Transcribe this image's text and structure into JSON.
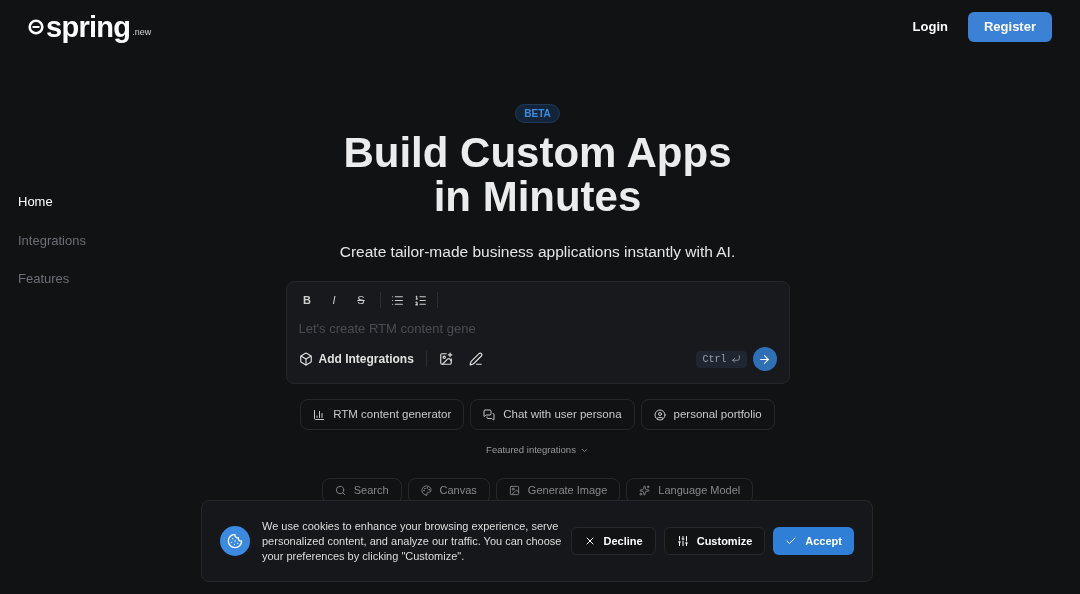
{
  "header": {
    "logo": {
      "name": "spring",
      "suffix": ".new"
    },
    "login": "Login",
    "register": "Register"
  },
  "sidebar": {
    "items": [
      {
        "label": "Home",
        "selected": true
      },
      {
        "label": "Integrations",
        "selected": false
      },
      {
        "label": "Features",
        "selected": false
      }
    ]
  },
  "hero": {
    "badge": "BETA",
    "title_lines": [
      "Build Custom Apps",
      "in Minutes"
    ],
    "subtitle": "Create tailor-made business applications instantly with AI."
  },
  "editor": {
    "toolbar": [
      "B",
      "I",
      "S"
    ],
    "placeholder": "Let's create RTM content gene",
    "add_integrations": "Add Integrations",
    "shortcut": "Ctrl"
  },
  "suggestions": [
    {
      "kind": "chart",
      "label": "RTM content generator"
    },
    {
      "kind": "chat",
      "label": "Chat with user persona"
    },
    {
      "kind": "user",
      "label": "personal portfolio"
    }
  ],
  "featured": {
    "label": "Featured integrations",
    "chips": [
      "Search",
      "Canvas",
      "Generate Image",
      "Language Model"
    ]
  },
  "cookie_banner": {
    "text": "We use cookies to enhance your browsing experience, serve personalized content, and analyze our traffic. You can choose your preferences by clicking \"Customize\".",
    "decline": "Decline",
    "customize": "Customize",
    "accept": "Accept"
  }
}
